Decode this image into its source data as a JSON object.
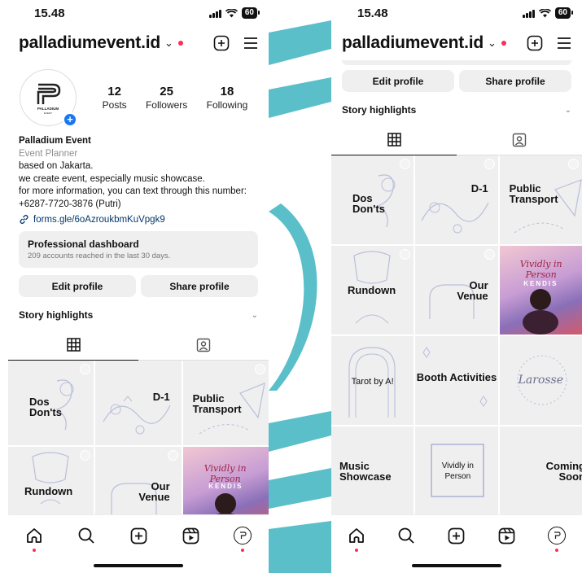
{
  "status": {
    "time": "15.48",
    "battery": "60"
  },
  "profile": {
    "username": "palladiumevent.id",
    "stats": [
      {
        "value": "12",
        "label": "Posts"
      },
      {
        "value": "25",
        "label": "Followers"
      },
      {
        "value": "18",
        "label": "Following"
      }
    ],
    "bio": {
      "name": "Palladium Event",
      "category": "Event Planner",
      "lines": [
        "based on Jakarta.",
        "we create event, especially music showcase.",
        "for more information, you can text through this number:",
        "+6287-7720-3876 (Putri)"
      ],
      "link": "forms.gle/6oAzroukbmKuVpgk9"
    },
    "dashboard": {
      "title": "Professional dashboard",
      "subtitle": "209 accounts reached in the last 30 days."
    },
    "buttons": {
      "edit": "Edit profile",
      "share": "Share profile"
    },
    "highlights_label": "Story highlights",
    "logo": {
      "line1": "PALLADIUM",
      "line2": "EVENT"
    }
  },
  "posts": [
    {
      "title": "Dos Don'ts"
    },
    {
      "title": "D-1"
    },
    {
      "title": "Public Transport"
    },
    {
      "title": "Rundown"
    },
    {
      "title": "Our Venue"
    },
    {
      "title": "Vividly in Person",
      "subtitle": "KENDIS"
    },
    {
      "title": "Tarot by A!"
    },
    {
      "title": "Booth Activities"
    },
    {
      "title": "Larosse"
    },
    {
      "title": "Music Showcase"
    },
    {
      "title": "Vividly in Person"
    },
    {
      "title": "Coming Soon"
    }
  ],
  "colors": {
    "accent": "#1877f2",
    "notification": "#ff2d55",
    "decor": "#5bbfca"
  }
}
